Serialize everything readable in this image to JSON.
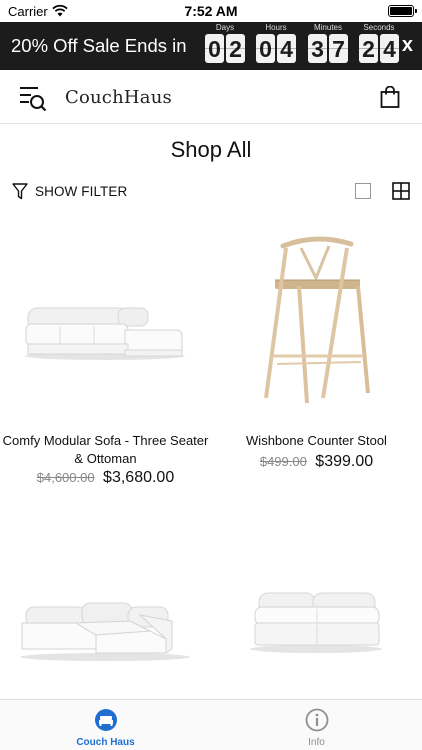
{
  "status_bar": {
    "carrier": "Carrier",
    "time": "7:52 AM"
  },
  "promo": {
    "text": "20% Off Sale Ends in",
    "countdown": [
      {
        "label": "Days",
        "digits": [
          "0",
          "2"
        ]
      },
      {
        "label": "Hours",
        "digits": [
          "0",
          "4"
        ]
      },
      {
        "label": "Minutes",
        "digits": [
          "3",
          "7"
        ]
      },
      {
        "label": "Seconds",
        "digits": [
          "2",
          "4"
        ]
      }
    ],
    "close": "x"
  },
  "header": {
    "logo": "CouchHaus"
  },
  "page": {
    "title": "Shop All",
    "filter_label": "SHOW FILTER"
  },
  "products": [
    {
      "name": "Comfy Modular Sofa - Three Seater & Ottoman",
      "old_price": "$4,600.00",
      "price": "$3,680.00"
    },
    {
      "name": "Wishbone Counter Stool",
      "old_price": "$499.00",
      "price": "$399.00"
    },
    {
      "name": "",
      "old_price": "",
      "price": ""
    },
    {
      "name": "",
      "old_price": "",
      "price": ""
    }
  ],
  "tabbar": {
    "tabs": [
      {
        "label": "Couch Haus",
        "active": true
      },
      {
        "label": "Info",
        "active": false
      }
    ]
  },
  "colors": {
    "accent": "#1e6fd0",
    "banner": "#1c1c1c",
    "inactive": "#8e8e93"
  }
}
